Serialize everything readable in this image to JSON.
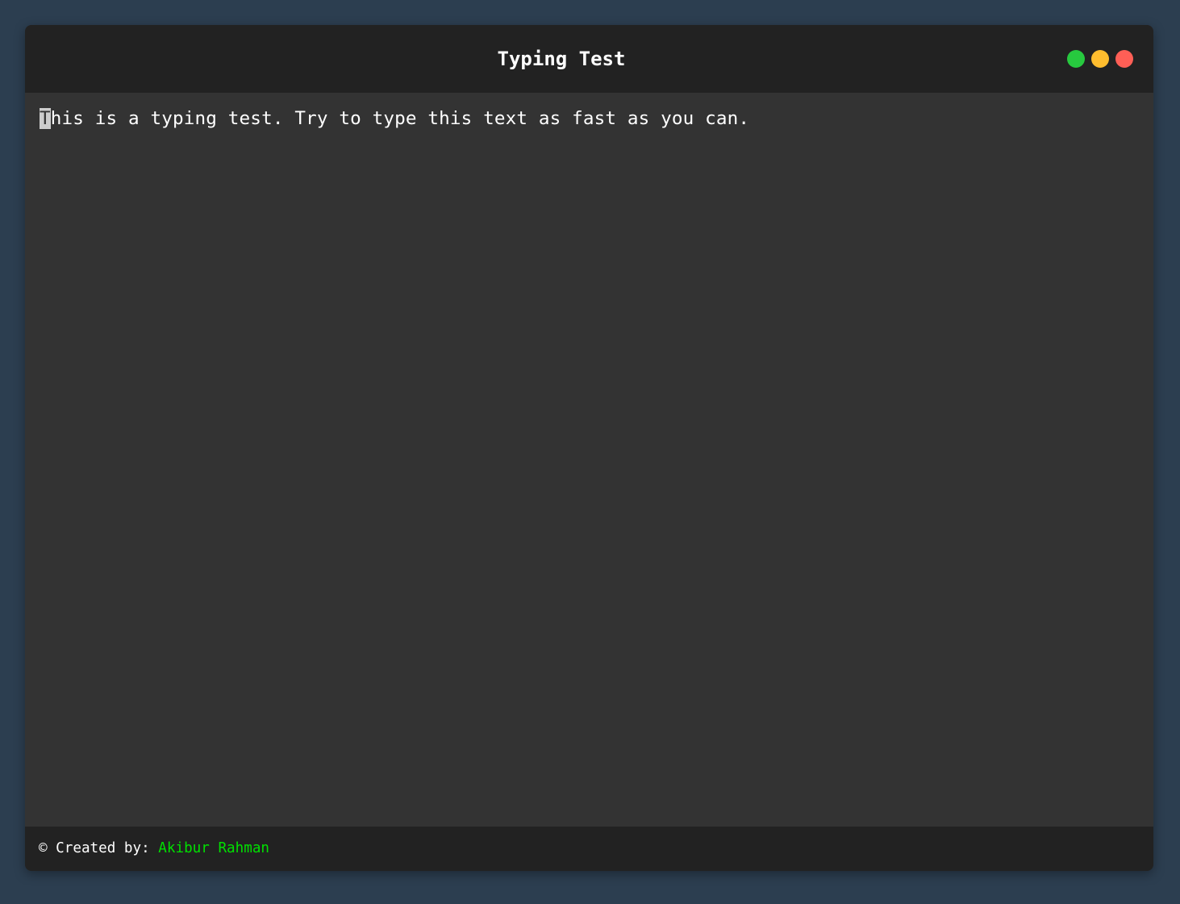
{
  "window": {
    "title": "Typing Test",
    "controls": [
      {
        "name": "green",
        "color": "#27c93f"
      },
      {
        "name": "yellow",
        "color": "#ffbd2e"
      },
      {
        "name": "red",
        "color": "#ff5f56"
      }
    ]
  },
  "test": {
    "cursor_char": "T",
    "remaining_text": "his is a typing test. Try to type this text as fast as you can."
  },
  "footer": {
    "prefix": "© Created by: ",
    "author": "Akibur Rahman",
    "author_color": "#00e000"
  },
  "colors": {
    "page_background": "#2c3e50",
    "titlebar": "#222222",
    "content": "#333333"
  }
}
